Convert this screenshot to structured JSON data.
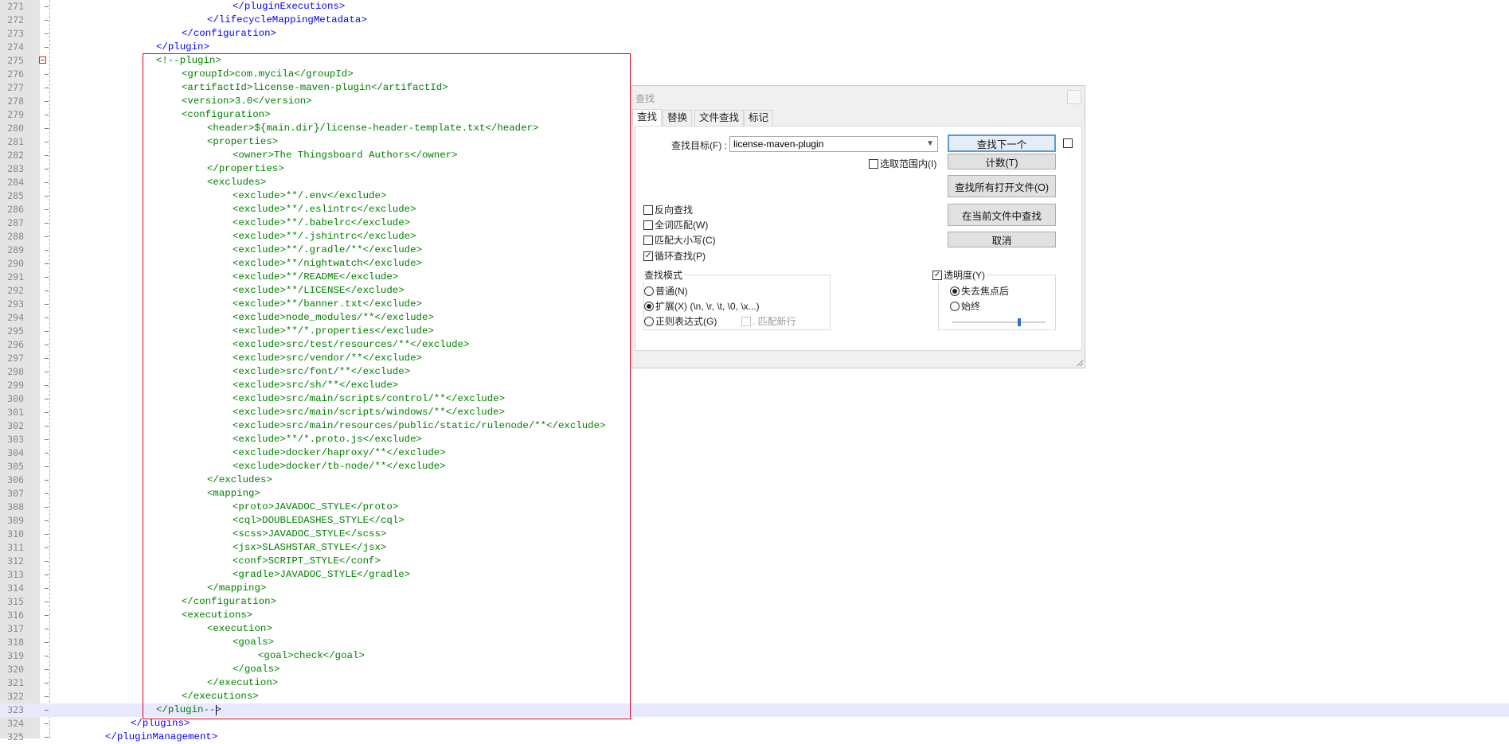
{
  "editor": {
    "current_line": "323",
    "folded_line": "275",
    "lines": [
      {
        "n": "271",
        "indent": 7,
        "code": [
          [
            "t",
            "</pluginExecutions>"
          ]
        ]
      },
      {
        "n": "272",
        "indent": 6,
        "code": [
          [
            "t",
            "</lifecycleMappingMetadata>"
          ]
        ]
      },
      {
        "n": "273",
        "indent": 5,
        "code": [
          [
            "t",
            "</configuration>"
          ]
        ]
      },
      {
        "n": "274",
        "indent": 4,
        "code": [
          [
            "t",
            "</plugin>"
          ]
        ]
      },
      {
        "n": "275",
        "indent": 4,
        "code": [
          [
            "c",
            "<!--plugin>"
          ]
        ]
      },
      {
        "n": "276",
        "indent": 5,
        "code": [
          [
            "c",
            "<groupId>com.mycila</groupId>"
          ]
        ]
      },
      {
        "n": "277",
        "indent": 5,
        "code": [
          [
            "c",
            "<artifactId>license-maven-plugin</artifactId>"
          ]
        ]
      },
      {
        "n": "278",
        "indent": 5,
        "code": [
          [
            "c",
            "<version>3.0</version>"
          ]
        ]
      },
      {
        "n": "279",
        "indent": 5,
        "code": [
          [
            "c",
            "<configuration>"
          ]
        ]
      },
      {
        "n": "280",
        "indent": 6,
        "code": [
          [
            "c",
            "<header>${main.dir}/license-header-template.txt</header>"
          ]
        ]
      },
      {
        "n": "281",
        "indent": 6,
        "code": [
          [
            "c",
            "<properties>"
          ]
        ]
      },
      {
        "n": "282",
        "indent": 7,
        "code": [
          [
            "c",
            "<owner>The Thingsboard Authors</owner>"
          ]
        ]
      },
      {
        "n": "283",
        "indent": 6,
        "code": [
          [
            "c",
            "</properties>"
          ]
        ]
      },
      {
        "n": "284",
        "indent": 6,
        "code": [
          [
            "c",
            "<excludes>"
          ]
        ]
      },
      {
        "n": "285",
        "indent": 7,
        "code": [
          [
            "c",
            "<exclude>**/.env</exclude>"
          ]
        ]
      },
      {
        "n": "286",
        "indent": 7,
        "code": [
          [
            "c",
            "<exclude>**/.eslintrc</exclude>"
          ]
        ]
      },
      {
        "n": "287",
        "indent": 7,
        "code": [
          [
            "c",
            "<exclude>**/.babelrc</exclude>"
          ]
        ]
      },
      {
        "n": "288",
        "indent": 7,
        "code": [
          [
            "c",
            "<exclude>**/.jshintrc</exclude>"
          ]
        ]
      },
      {
        "n": "289",
        "indent": 7,
        "code": [
          [
            "c",
            "<exclude>**/.gradle/**</exclude>"
          ]
        ]
      },
      {
        "n": "290",
        "indent": 7,
        "code": [
          [
            "c",
            "<exclude>**/nightwatch</exclude>"
          ]
        ]
      },
      {
        "n": "291",
        "indent": 7,
        "code": [
          [
            "c",
            "<exclude>**/README</exclude>"
          ]
        ]
      },
      {
        "n": "292",
        "indent": 7,
        "code": [
          [
            "c",
            "<exclude>**/LICENSE</exclude>"
          ]
        ]
      },
      {
        "n": "293",
        "indent": 7,
        "code": [
          [
            "c",
            "<exclude>**/banner.txt</exclude>"
          ]
        ]
      },
      {
        "n": "294",
        "indent": 7,
        "code": [
          [
            "c",
            "<exclude>node_modules/**</exclude>"
          ]
        ]
      },
      {
        "n": "295",
        "indent": 7,
        "code": [
          [
            "c",
            "<exclude>**/*.properties</exclude>"
          ]
        ]
      },
      {
        "n": "296",
        "indent": 7,
        "code": [
          [
            "c",
            "<exclude>src/test/resources/**</exclude>"
          ]
        ]
      },
      {
        "n": "297",
        "indent": 7,
        "code": [
          [
            "c",
            "<exclude>src/vendor/**</exclude>"
          ]
        ]
      },
      {
        "n": "298",
        "indent": 7,
        "code": [
          [
            "c",
            "<exclude>src/font/**</exclude>"
          ]
        ]
      },
      {
        "n": "299",
        "indent": 7,
        "code": [
          [
            "c",
            "<exclude>src/sh/**</exclude>"
          ]
        ]
      },
      {
        "n": "300",
        "indent": 7,
        "code": [
          [
            "c",
            "<exclude>src/main/scripts/control/**</exclude>"
          ]
        ]
      },
      {
        "n": "301",
        "indent": 7,
        "code": [
          [
            "c",
            "<exclude>src/main/scripts/windows/**</exclude>"
          ]
        ]
      },
      {
        "n": "302",
        "indent": 7,
        "code": [
          [
            "c",
            "<exclude>src/main/resources/public/static/rulenode/**</exclude>"
          ]
        ]
      },
      {
        "n": "303",
        "indent": 7,
        "code": [
          [
            "c",
            "<exclude>**/*.proto.js</exclude>"
          ]
        ]
      },
      {
        "n": "304",
        "indent": 7,
        "code": [
          [
            "c",
            "<exclude>docker/haproxy/**</exclude>"
          ]
        ]
      },
      {
        "n": "305",
        "indent": 7,
        "code": [
          [
            "c",
            "<exclude>docker/tb-node/**</exclude>"
          ]
        ]
      },
      {
        "n": "306",
        "indent": 6,
        "code": [
          [
            "c",
            "</excludes>"
          ]
        ]
      },
      {
        "n": "307",
        "indent": 6,
        "code": [
          [
            "c",
            "<mapping>"
          ]
        ]
      },
      {
        "n": "308",
        "indent": 7,
        "code": [
          [
            "c",
            "<proto>JAVADOC_STYLE</proto>"
          ]
        ]
      },
      {
        "n": "309",
        "indent": 7,
        "code": [
          [
            "c",
            "<cql>DOUBLEDASHES_STYLE</cql>"
          ]
        ]
      },
      {
        "n": "310",
        "indent": 7,
        "code": [
          [
            "c",
            "<scss>JAVADOC_STYLE</scss>"
          ]
        ]
      },
      {
        "n": "311",
        "indent": 7,
        "code": [
          [
            "c",
            "<jsx>SLASHSTAR_STYLE</jsx>"
          ]
        ]
      },
      {
        "n": "312",
        "indent": 7,
        "code": [
          [
            "c",
            "<conf>SCRIPT_STYLE</conf>"
          ]
        ]
      },
      {
        "n": "313",
        "indent": 7,
        "code": [
          [
            "c",
            "<gradle>JAVADOC_STYLE</gradle>"
          ]
        ]
      },
      {
        "n": "314",
        "indent": 6,
        "code": [
          [
            "c",
            "</mapping>"
          ]
        ]
      },
      {
        "n": "315",
        "indent": 5,
        "code": [
          [
            "c",
            "</configuration>"
          ]
        ]
      },
      {
        "n": "316",
        "indent": 5,
        "code": [
          [
            "c",
            "<executions>"
          ]
        ]
      },
      {
        "n": "317",
        "indent": 6,
        "code": [
          [
            "c",
            "<execution>"
          ]
        ]
      },
      {
        "n": "318",
        "indent": 7,
        "code": [
          [
            "c",
            "<goals>"
          ]
        ]
      },
      {
        "n": "319",
        "indent": 8,
        "code": [
          [
            "c",
            "<goal>check</goal>"
          ]
        ]
      },
      {
        "n": "320",
        "indent": 7,
        "code": [
          [
            "c",
            "</goals>"
          ]
        ]
      },
      {
        "n": "321",
        "indent": 6,
        "code": [
          [
            "c",
            "</execution>"
          ]
        ]
      },
      {
        "n": "322",
        "indent": 5,
        "code": [
          [
            "c",
            "</executions>"
          ]
        ]
      },
      {
        "n": "323",
        "indent": 4,
        "code": [
          [
            "c",
            "</plugin--"
          ],
          [
            "t",
            ">"
          ]
        ]
      },
      {
        "n": "324",
        "indent": 3,
        "code": [
          [
            "t",
            "</plugins>"
          ]
        ]
      },
      {
        "n": "325",
        "indent": 2,
        "code": [
          [
            "t",
            "</pluginManagement>"
          ]
        ]
      }
    ]
  },
  "find_dialog": {
    "title": "查找",
    "tabs": [
      "查找",
      "替换",
      "文件查找",
      "标记"
    ],
    "active_tab": "查找",
    "find_label": "查找目标(F) :",
    "find_value": "license-maven-plugin",
    "buttons": {
      "find_next": "查找下一个",
      "count": "计数(T)",
      "find_all_open": "查找所有打开文件(O)",
      "find_in_current": "在当前文件中查找",
      "cancel": "取消"
    },
    "in_selection": "选取范围内(I)",
    "options": {
      "backward": "反向查找",
      "whole_word": "全词匹配(W)",
      "match_case": "匹配大小写(C)",
      "wrap": "循环查找(P)"
    },
    "search_mode": {
      "title": "查找模式",
      "normal": "普通(N)",
      "extended": "扩展(X) (\\n, \\r, \\t, \\0, \\x...)",
      "regex": "正则表达式(G)",
      "dot_newline": ". 匹配新行"
    },
    "transparency": {
      "title": "透明度(Y)",
      "on_lose_focus": "失去焦点后",
      "always": "始终",
      "level": 0.72
    },
    "colors": {
      "comment": "#008000",
      "tag": "#0000ff",
      "highlight": "#e0001b"
    }
  }
}
